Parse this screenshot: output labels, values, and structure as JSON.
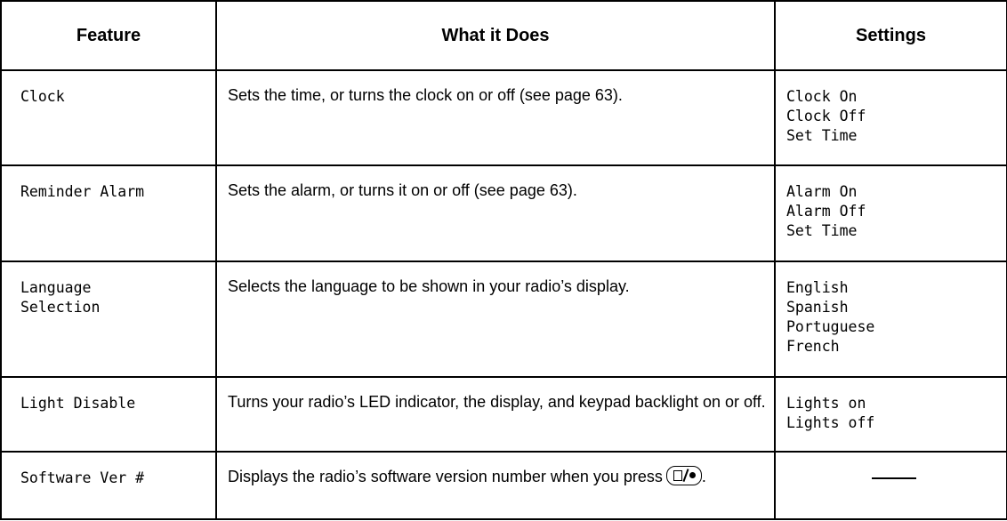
{
  "headers": {
    "feature": "Feature",
    "what": "What it Does",
    "settings": "Settings"
  },
  "rows": [
    {
      "feature": "Clock",
      "description": "Sets the time, or turns the clock on or off (see page 63).",
      "settings": [
        "Clock On",
        "Clock Off",
        "Set Time"
      ]
    },
    {
      "feature": "Reminder Alarm",
      "description": "Sets the alarm, or turns it on or off (see page 63).",
      "settings": [
        "Alarm On",
        "Alarm Off",
        "Set Time"
      ]
    },
    {
      "feature": "Language\nSelection",
      "description": "Selects the language to be shown in your radio’s display.",
      "settings": [
        "English",
        "Spanish",
        "Portuguese",
        "French"
      ]
    },
    {
      "feature": "Light Disable",
      "description": "Turns your radio’s LED indicator, the display, and keypad backlight on or off.",
      "settings": [
        "Lights on",
        "Lights off"
      ]
    },
    {
      "feature": "Software Ver #",
      "description": "Displays the radio’s software version number when you press",
      "description_end": ".",
      "description_icon": "menu-select-button-icon",
      "settings": []
    }
  ]
}
